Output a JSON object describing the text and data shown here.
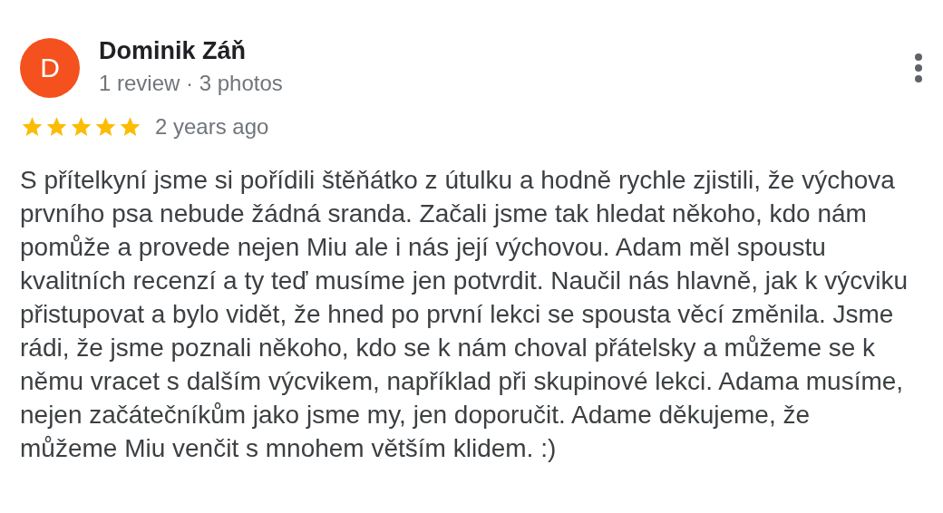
{
  "review": {
    "author": {
      "initial": "D",
      "name": "Dominik Záň",
      "meta": "1 review · 3 photos",
      "color": "#f4511e"
    },
    "stars": 5,
    "time": "2 years ago",
    "text": "S přítelkyní jsme si pořídili štěňátko z útulku a hodně rychle zjistili, že výchova prvního psa nebude žádná sranda. Začali jsme tak hledat někoho, kdo nám pomůže a provede nejen Miu ale i nás její výchovou. Adam měl spoustu kvalitních recenzí a ty teď musíme jen potvrdit. Naučil nás hlavně, jak k výcviku přistupovat a bylo vidět, že hned po první lekci se spousta věcí změnila. Jsme rádi, že jsme poznali někoho, kdo se k nám choval přátelsky a můžeme se k němu vracet s dalším výcvikem, například při skupinové lekci. Adama musíme, nejen začátečníkům jako jsme my, jen doporučit. Adame děkujeme, že můžeme Miu venčit s mnohem větším klidem. :)"
  }
}
